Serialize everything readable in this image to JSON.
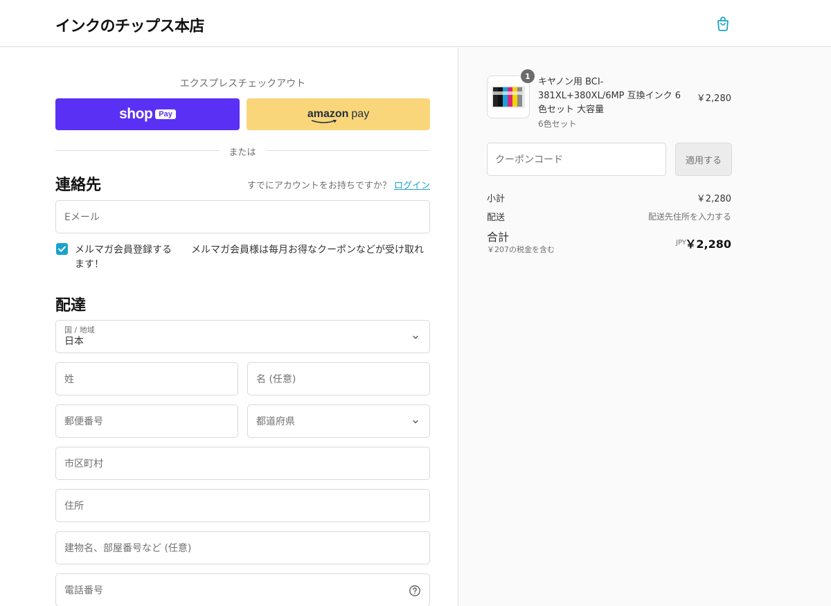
{
  "header": {
    "store_name": "インクのチップス本店"
  },
  "express": {
    "title": "エクスプレスチェックアウト",
    "shop_pay_text": "shop",
    "shop_pay_badge": "Pay",
    "amazon_text": "amazon",
    "amazon_pay_text": "pay",
    "divider": "または"
  },
  "contact": {
    "title": "連絡先",
    "login_prompt": "すでにアカウントをお持ちですか？",
    "login_link": "ログイン",
    "email_placeholder": "Eメール",
    "newsletter_label": "メルマガ会員登録する　　メルマガ会員様は毎月お得なクーポンなどが受け取れます！",
    "newsletter_checked": true
  },
  "delivery": {
    "title": "配達",
    "country_label": "国 / 地域",
    "country_value": "日本",
    "last_name": "姓",
    "first_name": "名 (任意)",
    "postal_code": "郵便番号",
    "prefecture": "都道府県",
    "city": "市区町村",
    "address": "住所",
    "building": "建物名、部屋番号など (任意)",
    "phone": "電話番号"
  },
  "summary": {
    "product": {
      "quantity": "1",
      "name": "キヤノン用 BCI-381XL+380XL/6MP 互換インク 6色セット 大容量",
      "variant": "6色セット",
      "price": "￥2,280"
    },
    "coupon_placeholder": "クーポンコード",
    "apply_label": "適用する",
    "subtotal_label": "小計",
    "subtotal_value": "￥2,280",
    "shipping_label": "配送",
    "shipping_value": "配送先住所を入力する",
    "total_label": "合計",
    "tax_note": "￥207の税金を含む",
    "currency": "JPY",
    "total_value": "￥2,280"
  },
  "colors": {
    "shop_pay": "#5a31f4",
    "amazon_pay": "#f9d67a",
    "accent": "#1aa3c9"
  }
}
